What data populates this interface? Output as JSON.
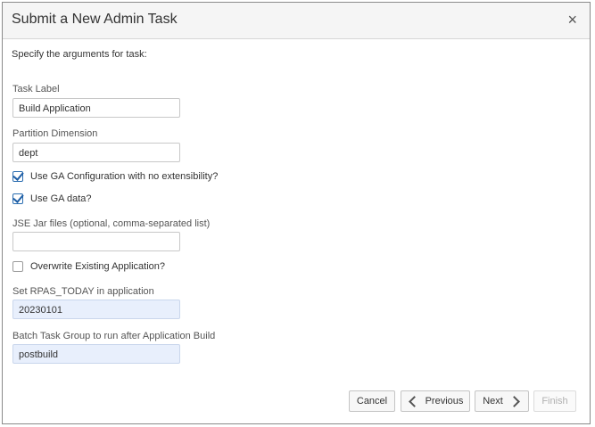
{
  "dialog": {
    "title": "Submit a New Admin Task",
    "close_glyph": "×",
    "instructions": "Specify the arguments for task:"
  },
  "fields": {
    "task_label": {
      "label": "Task Label",
      "value": "Build Application"
    },
    "partition_dimension": {
      "label": "Partition Dimension",
      "value": "dept"
    },
    "jse_jar_files": {
      "label": "JSE Jar files (optional, comma-separated list)",
      "value": ""
    },
    "rpas_today": {
      "label": "Set RPAS_TODAY in application",
      "value": "20230101"
    },
    "batch_task_group": {
      "label": "Batch Task Group to run after Application Build",
      "value": "postbuild"
    }
  },
  "checkboxes": {
    "use_ga_config": {
      "label": "Use GA Configuration with no extensibility?",
      "checked": true
    },
    "use_ga_data": {
      "label": "Use GA data?",
      "checked": true
    },
    "overwrite_app": {
      "label": "Overwrite Existing Application?",
      "checked": false
    }
  },
  "buttons": {
    "cancel": "Cancel",
    "previous": "Previous",
    "next": "Next",
    "finish": "Finish"
  },
  "icons": {
    "close": "close-icon",
    "previous": "chevron-left-icon",
    "next": "chevron-right-icon",
    "check": "checkmark-icon"
  },
  "colors": {
    "header_bg": "#f5f5f5",
    "highlight_field_bg": "#e8effc",
    "checkbox_accent": "#1f5fa6"
  }
}
